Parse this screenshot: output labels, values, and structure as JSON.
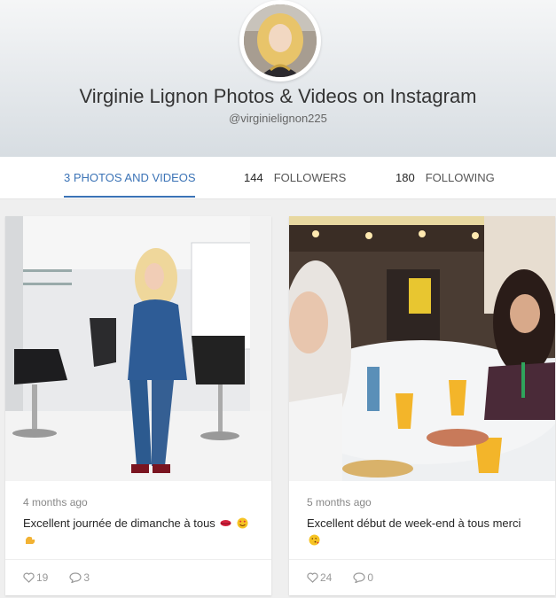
{
  "profile": {
    "name": "Virginie Lignon Photos & Videos on Instagram",
    "handle": "@virginielignon225"
  },
  "stats": {
    "media_label": "3 PHOTOS AND VIDEOS",
    "followers_count": "144",
    "followers_label": "FOLLOWERS",
    "following_count": "180",
    "following_label": "FOLLOWING"
  },
  "posts": [
    {
      "time": "4 months ago",
      "caption": "Excellent journée de dimanche à tous",
      "caption_emoji": [
        "kiss-mark-emoji",
        "heart-eyes-emoji",
        "flexed-biceps-emoji"
      ],
      "likes": "19",
      "comments": "3"
    },
    {
      "time": "5 months ago",
      "caption": "Excellent début de week-end à tous merci",
      "caption_emoji": [
        "face-blowing-kiss-emoji"
      ],
      "likes": "24",
      "comments": "0"
    }
  ],
  "colors": {
    "accent": "#3b73b6",
    "header_bg_top": "#f5f6f7",
    "header_bg_bottom": "#d7dde2",
    "page_bg": "#efefef"
  }
}
